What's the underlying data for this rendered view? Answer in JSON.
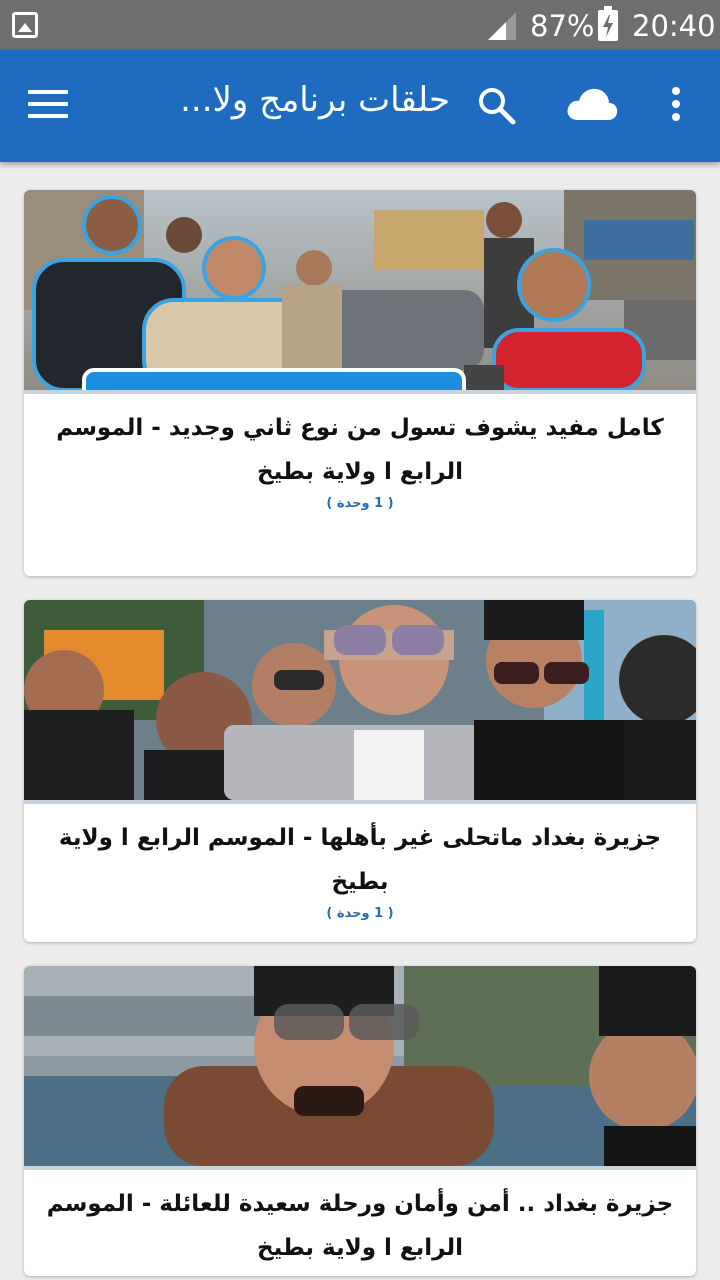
{
  "status_bar": {
    "battery_percent": "87%",
    "time": "20:40"
  },
  "app_bar": {
    "title": "حلقات برنامج ولا...",
    "icons": [
      "overflow-menu-icon",
      "cloud-icon",
      "search-icon",
      "hamburger-menu-icon"
    ]
  },
  "cards": [
    {
      "title": "كامل مفيد يشوف تسول من نوع ثاني وجديد - الموسم الرابع ا ولاية بطيخ",
      "count": "( 1 وحدة )"
    },
    {
      "title": "جزيرة بغداد ماتحلى غير بأهلها - الموسم الرابع ا ولاية بطيخ",
      "count": "( 1 وحدة )"
    },
    {
      "title": "جزيرة بغداد .. أمن وأمان ورحلة سعيدة للعائلة - الموسم الرابع ا ولاية بطيخ",
      "count": ""
    }
  ],
  "colors": {
    "app_bar": "#1e6bbf",
    "status_bar": "#6e6e6e",
    "background": "#ececec",
    "count_text": "#2a6bb0"
  }
}
